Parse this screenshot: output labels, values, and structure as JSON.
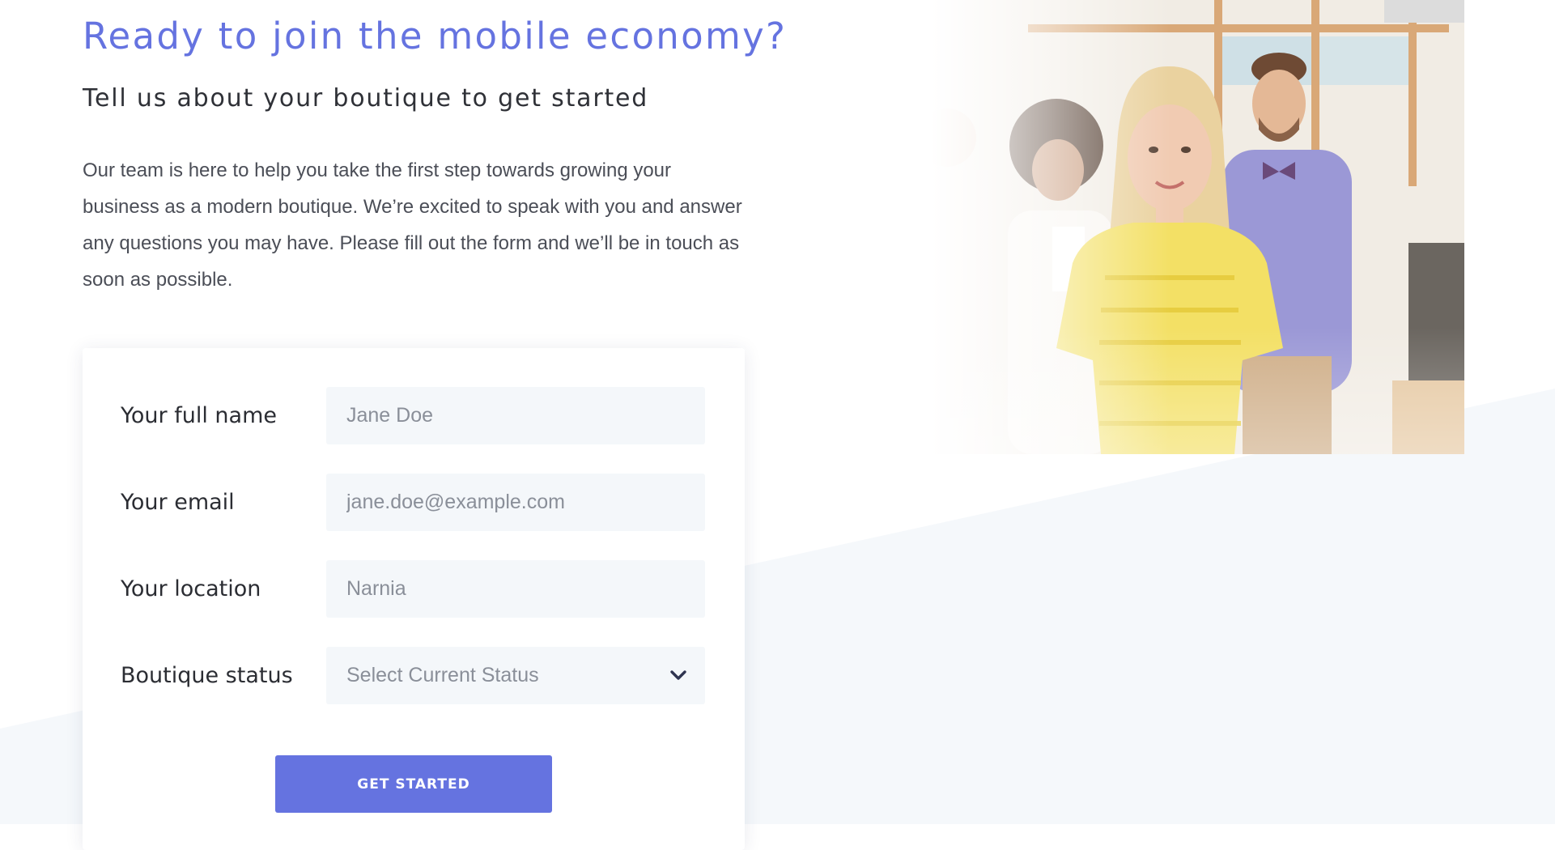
{
  "hero": {
    "headline": "Ready to join the mobile economy?",
    "subheadline": "Tell us about your boutique to get started",
    "intro": "Our team is here to help you take the first step towards growing your business as a modern boutique. We’re excited to speak with you and answer any questions you may have. Please fill out the form and we’ll be in touch as soon as possible."
  },
  "form": {
    "full_name": {
      "label": "Your full name",
      "placeholder": "Jane Doe",
      "value": ""
    },
    "email": {
      "label": "Your email",
      "placeholder": "jane.doe@example.com",
      "value": ""
    },
    "location": {
      "label": "Your location",
      "placeholder": "Narnia",
      "value": ""
    },
    "status": {
      "label": "Boutique status",
      "selected": "Select Current Status"
    },
    "submit_label": "GET STARTED"
  },
  "icons": {
    "select_toggle": "chevron-down-icon"
  },
  "colors": {
    "accent": "#6573e0",
    "heading_text": "#2f3137",
    "body_text": "#4b4e57",
    "placeholder_text": "#8a8f99",
    "input_background": "#f4f7fa",
    "section_background": "#f5f8fb"
  }
}
